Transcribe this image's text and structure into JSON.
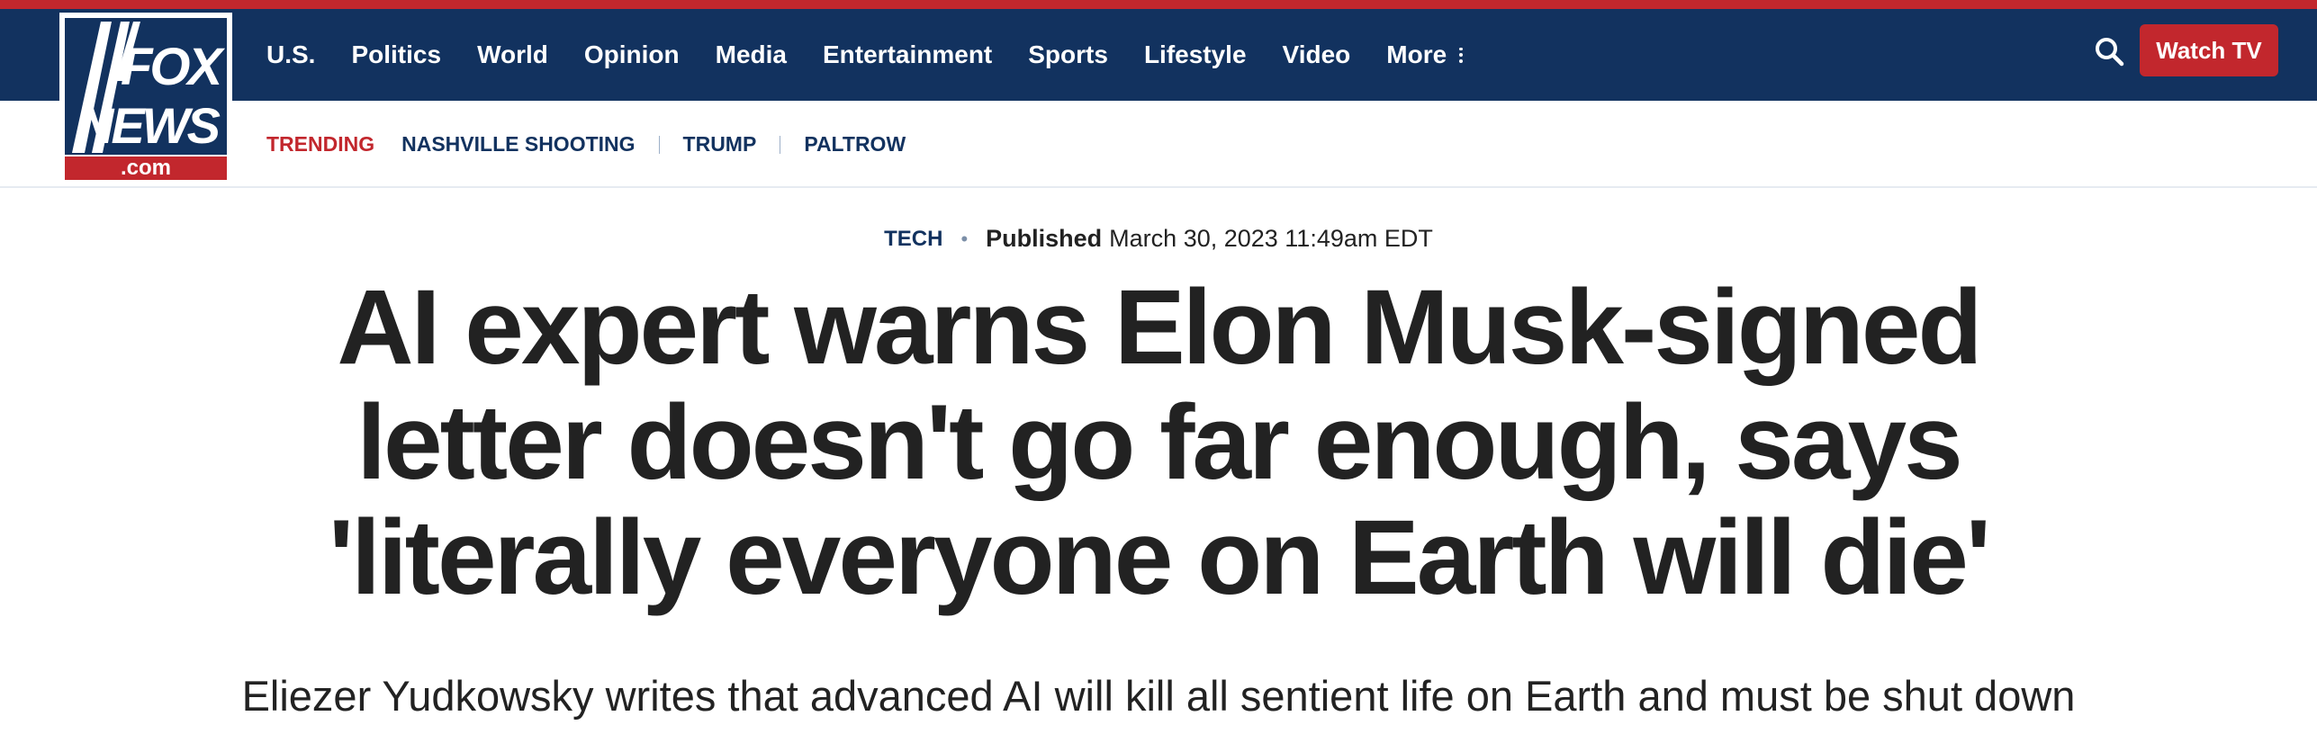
{
  "brand": {
    "logo_top": "FOX",
    "logo_bottom": "NEWS",
    "logo_domain": ".com",
    "colors": {
      "navy": "#12325f",
      "red": "#c2272d",
      "text": "#222222"
    }
  },
  "nav": {
    "items": [
      "U.S.",
      "Politics",
      "World",
      "Opinion",
      "Media",
      "Entertainment",
      "Sports",
      "Lifestyle",
      "Video"
    ],
    "more_label": "More",
    "more_icon": "vertical-dots-icon",
    "search_icon": "search-icon",
    "watch_tv_label": "Watch TV"
  },
  "trending": {
    "label": "TRENDING",
    "items": [
      "NASHVILLE SHOOTING",
      "TRUMP",
      "PALTROW"
    ]
  },
  "article": {
    "category": "TECH",
    "published_label": "Published",
    "published_date": "March 30, 2023 11:49am EDT",
    "headline_lines": [
      "AI expert warns Elon Musk-signed",
      "letter doesn't go far enough, says",
      "'literally everyone on Earth will die'"
    ],
    "subheadline": "Eliezer Yudkowsky writes that advanced AI will kill all sentient life on Earth and must be shut down"
  }
}
